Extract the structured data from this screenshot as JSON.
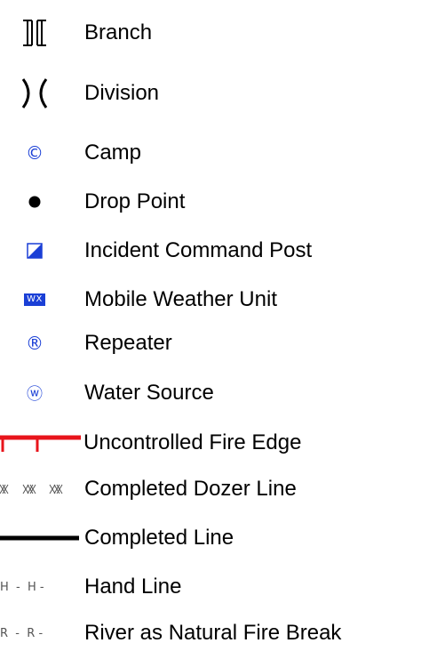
{
  "legend": {
    "items": [
      {
        "label": "Branch",
        "symbol": "branch-icon"
      },
      {
        "label": "Division",
        "symbol": "division-icon"
      },
      {
        "label": "Camp",
        "symbol": "camp-icon",
        "glyph": "©"
      },
      {
        "label": "Drop Point",
        "symbol": "drop-point-icon"
      },
      {
        "label": "Incident Command Post",
        "symbol": "incident-command-post-icon"
      },
      {
        "label": "Mobile Weather Unit",
        "symbol": "mobile-weather-unit-icon",
        "glyph": "WX"
      },
      {
        "label": "Repeater",
        "symbol": "repeater-icon",
        "glyph": "®"
      },
      {
        "label": "Water Source",
        "symbol": "water-source-icon",
        "glyph": "ⓦ"
      },
      {
        "label": "Uncontrolled Fire Edge",
        "symbol": "uncontrolled-fire-edge-line"
      },
      {
        "label": "Completed Dozer Line",
        "symbol": "completed-dozer-line"
      },
      {
        "label": "Completed Line",
        "symbol": "completed-line"
      },
      {
        "label": "Hand Line",
        "symbol": "hand-line",
        "glyph": "H"
      },
      {
        "label": "River as Natural Fire Break",
        "symbol": "river-natural-fire-break-line",
        "glyph": "R"
      }
    ]
  },
  "colors": {
    "symbol_blue": "#1a3fd6",
    "fire_edge_red": "#e8141b",
    "line_black": "#000000",
    "dash_grey": "#555555"
  }
}
